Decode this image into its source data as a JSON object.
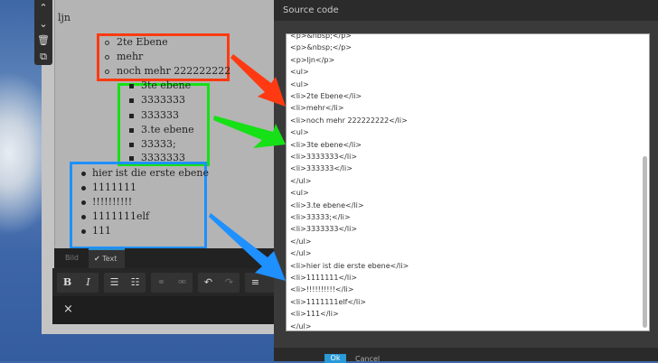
{
  "editor": {
    "paragraph": "ljn",
    "level2_items": [
      "2te Ebene",
      "mehr",
      "noch mehr 222222222"
    ],
    "level3_items": [
      "3te ebene",
      "3333333",
      "333333",
      "3.te ebene",
      "33333;",
      "3333333"
    ],
    "level1_items": [
      "hier ist die erste ebene",
      "1111111",
      "!!!!!!!!!!",
      "1111111elf",
      "111"
    ],
    "tabs": [
      "Bild",
      "Text"
    ],
    "close_label": "×"
  },
  "dialog": {
    "title": "Source code",
    "lines": [
      "<p>&nbsp;</p>",
      "<p>&nbsp;</p>",
      "<p>ljn</p>",
      "<ul>",
      "<ul>",
      "<li>2te Ebene</li>",
      "<li>mehr</li>",
      "<li>noch mehr 222222222</li>",
      "<ul>",
      "<li>3te ebene</li>",
      "<li>3333333</li>",
      "<li>333333</li>",
      "</ul>",
      "<ul>",
      "<li>3.te ebene</li>",
      "<li>33333;</li>",
      "<li>3333333</li>",
      "</ul>",
      "</ul>",
      "<li>hier ist die erste ebene</li>",
      "<li>1111111</li>",
      "<li>!!!!!!!!!!</li>",
      "<li>1111111elf</li>",
      "<li>111</li>",
      "</ul>"
    ],
    "ok_label": "Ok",
    "cancel_label": "Cancel"
  },
  "colors": {
    "red": "#ff3a12",
    "green": "#16e016",
    "blue": "#1e90ff",
    "accent": "#2a9ad8"
  }
}
